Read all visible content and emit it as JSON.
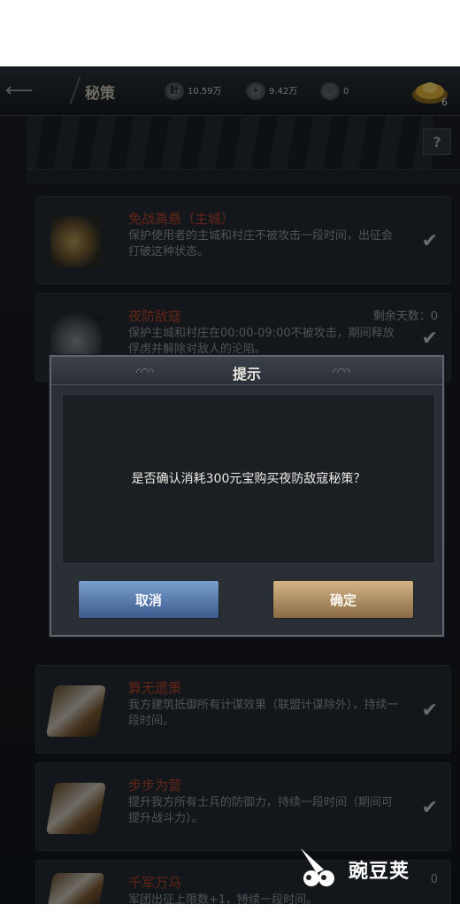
{
  "header": {
    "back_icon": "arrow-left-icon",
    "title": "秘策",
    "resources": [
      {
        "icon": "ji-icon",
        "glyph": "計",
        "value": "10.59万"
      },
      {
        "icon": "plus-icon",
        "glyph": "+",
        "value": "9.42万"
      },
      {
        "icon": "coin-icon",
        "glyph": "◎",
        "value": "0"
      }
    ],
    "gold_badge": "6",
    "help": "?"
  },
  "strategies": [
    {
      "name": "免战高悬（主城）",
      "desc": "保护使用者的主城和村庄不被攻击一段时间，出征会打破这种状态。",
      "extra": ""
    },
    {
      "name": "夜防敌寇",
      "desc": "保护主城和村庄在00:00-09:00不被攻击，期间释放俘虏并解除对敌人的沦陷。",
      "extra": "剩余天数：0"
    },
    {
      "name": "算无遗策",
      "desc": "我方建筑抵御所有计谋效果（联盟计谋除外），持续一段时间。",
      "extra": ""
    },
    {
      "name": "步步为营",
      "desc": "提升我方所有士兵的防御力，持续一段时间（期间可提升战斗力）。",
      "extra": ""
    },
    {
      "name": "千军万马",
      "desc": "军团出征上限数+1，持续一段时间。",
      "extra": "0"
    }
  ],
  "dialog": {
    "title": "提示",
    "message": "是否确认消耗300元宝购买夜防敌寇秘策？",
    "cancel_label": "取消",
    "ok_label": "确定"
  },
  "watermark": {
    "text": "豌豆荚"
  },
  "colors": {
    "accent_red": "#b6452a",
    "cancel_blue": "#4f74a8",
    "ok_gold": "#b8956a"
  }
}
